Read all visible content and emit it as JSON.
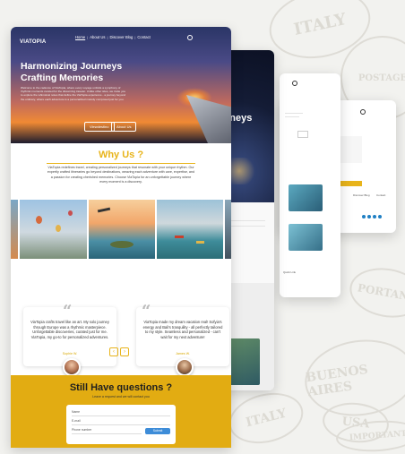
{
  "brand": {
    "logo": "VIATOPIA"
  },
  "nav": {
    "items": [
      "Home",
      "About Us",
      "Discover Blog",
      "Contact"
    ]
  },
  "hero": {
    "title_line1": "Harmonizing Journeys",
    "title_line2": "Crafting Memories",
    "body": "Welcome to the cadence of ViaTopia, where every voyage unfolds a symphony of rhythmic moments curated for the discerning traveler. Unlike other sites, we invite you to explore the whimsical notes that define the ViaTopia experience - a journey beyond the ordinary, where each adventure is a personalized melody composed just for you.",
    "btn1": "Viewdestino",
    "btn2": "About Us"
  },
  "why": {
    "title": "Why Us ?",
    "body": "ViaTopia redefines travel, creating personalized journeys that resonate with your unique rhythm. Our expertly crafted itineraries go beyond destinations, weaving each adventure with care, expertise, and a passion for creating cherished memories. Choose ViaTopia for an unforgettable journey where every moment is a discovery."
  },
  "testimonials": [
    {
      "quote": "ViaTopia crafts travel like an art. My solo journey through Europe was a rhythmic masterpiece. Unforgettable discoveries, curated just for me. ViaTopia, my go-to for personalized adventures.",
      "name": "Sophie W."
    },
    {
      "quote": "ViaTopia made my dream vacation real! Sofyia's energy and Bali's tranquility - all perfectly tailored to my style. Seamless and personalized - can't wait for my next adventure!",
      "name": "James W."
    }
  ],
  "contact": {
    "title": "Still Have questions ?",
    "subtitle": "Leave a request and we will contact you",
    "fields": [
      "Name",
      "E-mail",
      "Phone number"
    ],
    "submit": "Submit"
  },
  "back_pages": {
    "hero_partial": "rneys",
    "footer_cols": [
      "Quick Link",
      "Discover Blog",
      "Contact"
    ],
    "envato": "envato"
  },
  "stamps": [
    "ITALY",
    "PORTANT",
    "BUENOS AIRES",
    "USA",
    "IMPORTANT",
    "ITALY",
    "POSTAGE"
  ],
  "colors": {
    "accent": "#e8b41b",
    "hero_dark": "#1a2440",
    "footer_blue": "#1f7fc4"
  }
}
